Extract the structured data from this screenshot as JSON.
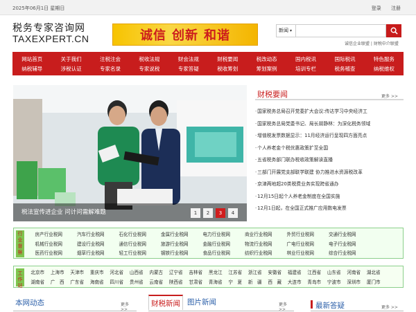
{
  "topbar": {
    "date": "2025年06月1日 星期日",
    "login": "登录",
    "register": "注册"
  },
  "logo": {
    "cn": "税务专家咨询网",
    "en": "TAXEXPERT.CN"
  },
  "banner": {
    "w1": "诚信",
    "w2": "创新",
    "w3": "和谐"
  },
  "search": {
    "select": "新闻",
    "placeholder": ""
  },
  "sublinks": "诚信企业联盟 | 财税中介联盟",
  "nav": {
    "row1": [
      "网站首页",
      "关于我们",
      "注税注会",
      "税收法规",
      "财会法规",
      "财税要闻",
      "税改动态",
      "国内税讯",
      "国际税讯",
      "特色服务"
    ],
    "row2": [
      "纳税辅导",
      "涉税认证",
      "专家名录",
      "专家说税",
      "专家答疑",
      "税收筹划",
      "筹划案例",
      "培训专栏",
      "税务稽查",
      "纳税维权"
    ]
  },
  "hero": {
    "caption": "税法宣传进企业 问计问需解难题",
    "pages": [
      "1",
      "2",
      "3",
      "4"
    ],
    "active": 2
  },
  "news": {
    "title": "财税要闻",
    "more": "更多 >>",
    "items": [
      "国家税务总局召开党委扩大会议:传达学习中央经济工",
      "国家税务总局党委书记、局长胡静林：为深化税务领域",
      "增值税发票数据显示：11月经济运行呈现四方面亮点",
      "个人养老金个税优惠政策扩至全国",
      "五省税务部门联办税收政策解读直播",
      "三部门开展党支部联学联建 协力推进水资源税改革",
      "京津两地超20类税费业务实现跨省通办",
      "12月15日起个人养老金制度在全国实施",
      "12月1日起，在全国正式推广应用数电发票"
    ]
  },
  "industry": {
    "label": [
      "行",
      "业",
      "督",
      "察"
    ],
    "items": [
      "房产行业税网",
      "汽车行业税网",
      "石化行业税网",
      "金属行业税网",
      "电力行业税网",
      "商业行业税网",
      "外贸行业税网",
      "交通行业税网",
      "",
      "机械行业税网",
      "建设行业税网",
      "通信行业税网",
      "旅游行业税网",
      "金融行业税网",
      "物流行业税网",
      "广电行业税网",
      "电子行业税网",
      "",
      "医药行业税网",
      "烟草行业税网",
      "轻工行业税网",
      "钢铁行业税网",
      "食品行业税网",
      "纺织行业税网",
      "林业行业税网",
      "综合行业税网",
      ""
    ]
  },
  "station": {
    "label": [
      "工",
      "作",
      "站"
    ],
    "items": [
      "北京市",
      "上海市",
      "天津市",
      "重庆市",
      "河北省",
      "山西省",
      "内蒙古",
      "辽宁省",
      "吉林省",
      "黑龙江",
      "江苏省",
      "浙江省",
      "安徽省",
      "福建省",
      "江西省",
      "山东省",
      "河南省",
      "湖北省",
      "",
      "湖南省",
      "广　西",
      "广东省",
      "海南省",
      "四川省",
      "贵州省",
      "云南省",
      "陕西省",
      "甘肃省",
      "青海省",
      "宁　夏",
      "新　疆",
      "西　藏",
      "大连市",
      "青岛市",
      "宁波市",
      "深圳市",
      "厦门市",
      ""
    ]
  },
  "bottom": {
    "s1": {
      "title": "本网动态",
      "more": "更多 >>"
    },
    "s2": {
      "tab1": "财税新闻",
      "tab2": "图片新闻",
      "more": "更多 >>"
    },
    "s3": {
      "title": "最新答疑",
      "more": "更多 >>"
    }
  },
  "colors": {
    "brand_red": "#c81d1d",
    "link_blue": "#2b5fa9",
    "box_green": "#8bcf8b"
  }
}
